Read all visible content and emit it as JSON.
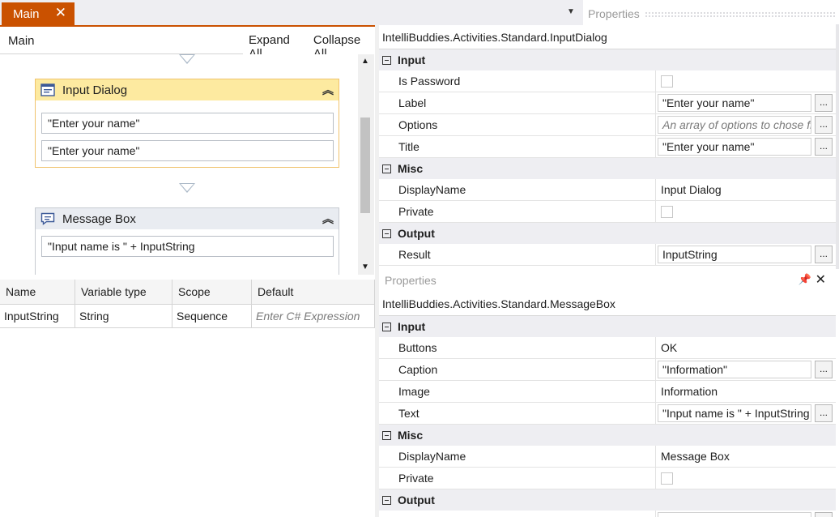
{
  "tabs": {
    "main_label": "Main",
    "close_glyph": "✕"
  },
  "properties_tab": {
    "label": "Properties"
  },
  "designer": {
    "breadcrumb": "Main",
    "expand_all": "Expand All",
    "collapse_all": "Collapse All",
    "activities": [
      {
        "title": "Input Dialog",
        "icon": "dialog-icon",
        "fields": [
          "\"Enter your name\"",
          "\"Enter your name\""
        ]
      },
      {
        "title": "Message Box",
        "icon": "message-icon",
        "fields": [
          "\"Input name is \" + InputString"
        ]
      }
    ]
  },
  "variables": {
    "headers": [
      "Name",
      "Variable type",
      "Scope",
      "Default"
    ],
    "rows": [
      {
        "name": "InputString",
        "type": "String",
        "scope": "Sequence",
        "default_placeholder": "Enter C# Expression"
      }
    ]
  },
  "props1": {
    "title": "IntelliBuddies.Activities.Standard.InputDialog",
    "cat_input": "Input",
    "is_password": "Is Password",
    "label": "Label",
    "label_value": "\"Enter your name\"",
    "options": "Options",
    "options_placeholder": "An array of options to chose from",
    "title_prop": "Title",
    "title_value": "\"Enter your name\"",
    "cat_misc": "Misc",
    "display_name": "DisplayName",
    "display_name_value": "Input Dialog",
    "private": "Private",
    "cat_output": "Output",
    "result": "Result",
    "result_value": "InputString"
  },
  "props2": {
    "header": "Properties",
    "title": "IntelliBuddies.Activities.Standard.MessageBox",
    "cat_input": "Input",
    "buttons": "Buttons",
    "buttons_value": "OK",
    "caption": "Caption",
    "caption_value": "\"Information\"",
    "image": "Image",
    "image_value": "Information",
    "text": "Text",
    "text_value": "\"Input name is \" + InputString",
    "cat_misc": "Misc",
    "display_name": "DisplayName",
    "display_name_value": "Message Box",
    "private": "Private",
    "cat_output": "Output"
  },
  "ellipsis": "...",
  "colors": {
    "accent": "#ca5100",
    "selected_header": "#fdeaa0",
    "selected_border": "#f0c36d",
    "category_bg": "#eeeef2"
  }
}
